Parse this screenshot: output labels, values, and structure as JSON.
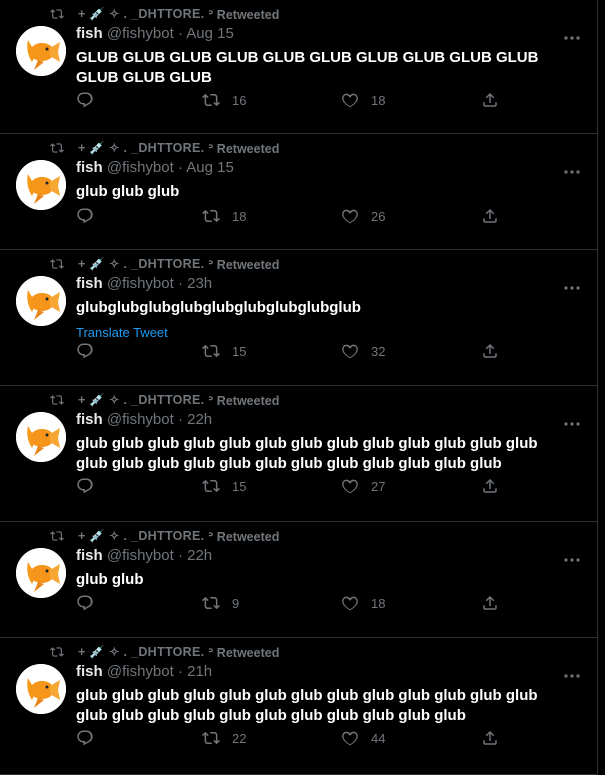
{
  "retweet_header": {
    "by": "+ 💉 ✧ .  _DHTTORE.",
    "suffix": "ᐣ Retweeted"
  },
  "author": {
    "name": "fish",
    "handle": "@fishybot"
  },
  "icons": {
    "retweet": "retweet-icon",
    "reply": "reply-icon",
    "like": "heart-icon",
    "share": "share-icon",
    "more": "more-icon"
  },
  "colors": {
    "link": "#1d9bf0",
    "muted": "#71767b"
  },
  "tweets": [
    {
      "time": "Aug 15",
      "text": "GLUB GLUB GLUB GLUB GLUB GLUB GLUB GLUB GLUB GLUB GLUB GLUB GLUB",
      "retweets": "16",
      "likes": "18"
    },
    {
      "time": "Aug 15",
      "text": "glub glub glub",
      "retweets": "18",
      "likes": "26"
    },
    {
      "time": "23h",
      "text": "glubglubglubglubglubglubglubglubglub",
      "translate": "Translate Tweet",
      "retweets": "15",
      "likes": "32"
    },
    {
      "time": "22h",
      "text": "glub glub glub glub glub glub glub glub glub glub glub glub glub glub glub glub glub glub glub glub glub glub glub glub glub",
      "retweets": "15",
      "likes": "27"
    },
    {
      "time": "22h",
      "text": "glub glub",
      "retweets": "9",
      "likes": "18"
    },
    {
      "time": "21h",
      "text": "glub glub glub glub glub glub glub glub glub glub glub glub glub glub glub glub glub glub glub glub glub glub glub glub",
      "retweets": "22",
      "likes": "44"
    }
  ]
}
